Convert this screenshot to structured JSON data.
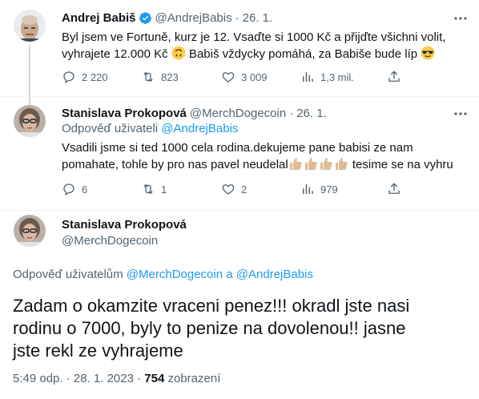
{
  "tweets": [
    {
      "name": "Andrej Babiš",
      "handle": "@AndrejBabis",
      "date": "26. 1.",
      "text_line1": "Byl jsem ve Fortuně, kurz je 12. Vsaďte si 1000 Kč a přijďte všichni volit,",
      "text_line2a": "vyhrajete 12.000 Kč ",
      "text_line2b": " Babiš vždycky pomáhá, za Babiše bude líp ",
      "replies": "2 220",
      "retweets": "823",
      "likes": "3 009",
      "views": "1,3 mil.",
      "verified_color": "#1d9bf0"
    },
    {
      "name": "Stanislava Prokopová",
      "handle": "@MerchDogecoin",
      "date": "26. 1.",
      "reply_prefix": "Odpověď uživateli ",
      "reply_link": "@AndrejBabis",
      "text_line1": "Vsadili jsme si ted 1000 cela rodina.dekujeme pane babisi ze nam",
      "text_line2a": "pomahate, tohle by pro nas pavel neudelal",
      "text_line2b": " tesime se na vyhru",
      "replies": "6",
      "retweets": "1",
      "likes": "2",
      "views": "979"
    }
  ],
  "main": {
    "name": "Stanislava Prokopová",
    "handle": "@MerchDogecoin",
    "reply_prefix": "Odpověď uživatelům ",
    "reply_link1": "@MerchDogecoin",
    "reply_and": " a ",
    "reply_link2": "@AndrejBabis",
    "text_line1": "Zadam o okamzite vraceni penez!!! okradl jste nasi",
    "text_line2": "rodinu o 7000, byly to penize na dovolenou!! jasne",
    "text_line3": "jste rekl ze vyhrajeme",
    "time": "5:49 odp. · 28. 1. 2023 · ",
    "views_count": "754",
    "views_label": " zobrazení"
  },
  "icons": {
    "reply": "reply-icon",
    "retweet": "retweet-icon",
    "like": "heart-icon",
    "views": "views-chart-icon",
    "share": "share-icon",
    "more": "more-icon"
  },
  "colors": {
    "accent": "#1d9bf0",
    "secondary": "#536471",
    "text": "#0f1419"
  }
}
